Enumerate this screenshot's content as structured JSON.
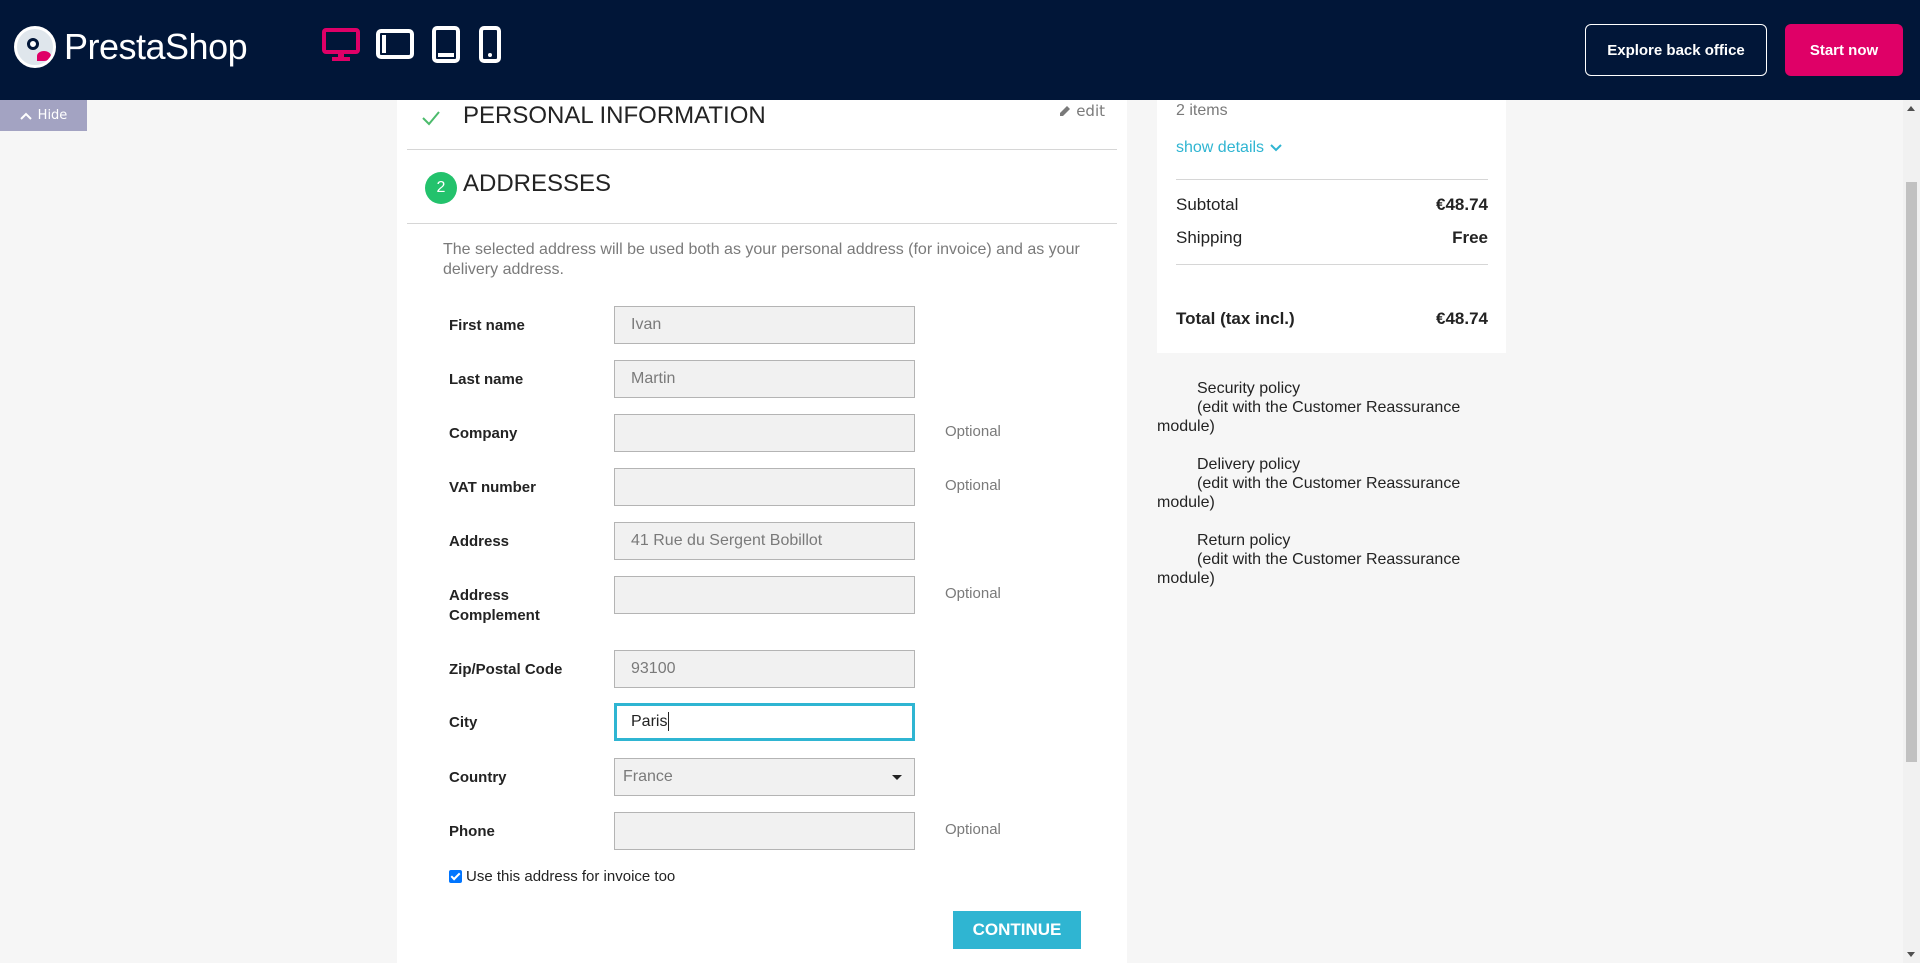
{
  "topbar": {
    "brand": "PrestaShop",
    "explore_label": "Explore back office",
    "start_label": "Start now",
    "colors": {
      "bg": "#011638",
      "accent": "#df0067"
    },
    "device_icons": [
      "desktop-icon",
      "tablet-landscape-icon",
      "tablet-portrait-icon",
      "mobile-icon"
    ]
  },
  "hide_label": "Hide",
  "checkout": {
    "personal_title": "PERSONAL INFORMATION",
    "edit_label": "edit",
    "addresses_step": "2",
    "addresses_title": "ADDRESSES",
    "intro": "The selected address will be used both as your personal address (for invoice) and as your delivery address.",
    "fields": {
      "first_name": {
        "label": "First name",
        "value": "Ivan"
      },
      "last_name": {
        "label": "Last name",
        "value": "Martin"
      },
      "company": {
        "label": "Company",
        "value": "",
        "optional": "Optional"
      },
      "vat": {
        "label": "VAT number",
        "value": "",
        "optional": "Optional"
      },
      "address": {
        "label": "Address",
        "value": "41 Rue du Sergent Bobillot"
      },
      "address2": {
        "label": "Address Complement",
        "value": "",
        "optional": "Optional"
      },
      "zip": {
        "label": "Zip/Postal Code",
        "value": "93100"
      },
      "city": {
        "label": "City",
        "value": "Paris"
      },
      "country": {
        "label": "Country",
        "value": "France"
      },
      "phone": {
        "label": "Phone",
        "value": "",
        "optional": "Optional"
      }
    },
    "invoice_checkbox": "Use this address for invoice too",
    "continue_label": "CONTINUE"
  },
  "cart": {
    "items": "2 items",
    "show_details": "show details",
    "subtotal_label": "Subtotal",
    "subtotal_value": "€48.74",
    "shipping_label": "Shipping",
    "shipping_value": "Free",
    "total_label": "Total (tax incl.)",
    "total_value": "€48.74"
  },
  "reassurance": [
    {
      "title": "Security policy",
      "note": "(edit with the Customer Reassurance",
      "cont": "module)"
    },
    {
      "title": "Delivery policy",
      "note": "(edit with the Customer Reassurance",
      "cont": "module)"
    },
    {
      "title": "Return policy",
      "note": "(edit with the Customer Reassurance",
      "cont": "module)"
    }
  ]
}
